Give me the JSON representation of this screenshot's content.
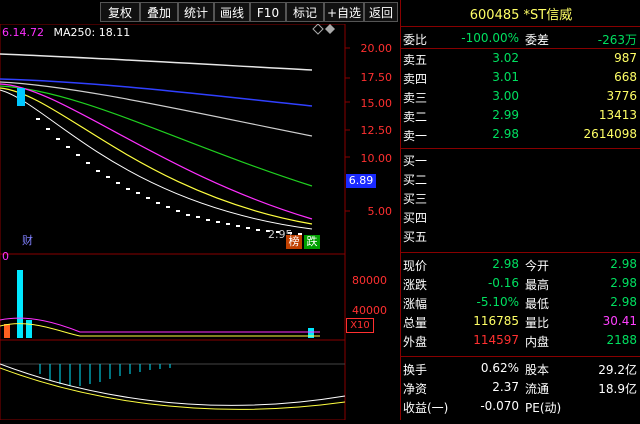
{
  "toolbar": {
    "buttons": [
      "复权",
      "叠加",
      "统计",
      "画线",
      "F10",
      "标记",
      "+自选",
      "返回"
    ]
  },
  "chart": {
    "ma_left": "6.14.72",
    "ma250": "MA250: 18.11",
    "y_axis": [
      "20.00",
      "17.50",
      "15.00",
      "12.50",
      "10.00",
      "5.00"
    ],
    "price_tag": "6.89",
    "low_label": "2.95",
    "badge_bang": "榜",
    "badge_die": "跌",
    "cai": "财",
    "vol_axis": [
      "80000",
      "40000"
    ],
    "vol_unit": "X10",
    "vol_left": "0"
  },
  "panel": {
    "title": "600485 *ST信威",
    "weibi_label": "委比",
    "weibi_value": "-100.00%",
    "weicha_label": "委差",
    "weicha_value": "-263万",
    "sells": [
      {
        "label": "卖五",
        "price": "3.02",
        "vol": "987"
      },
      {
        "label": "卖四",
        "price": "3.01",
        "vol": "668"
      },
      {
        "label": "卖三",
        "price": "3.00",
        "vol": "3776"
      },
      {
        "label": "卖二",
        "price": "2.99",
        "vol": "13413"
      },
      {
        "label": "卖一",
        "price": "2.98",
        "vol": "2614098"
      }
    ],
    "buys": [
      "买一",
      "买二",
      "买三",
      "买四",
      "买五"
    ],
    "stats": [
      {
        "l1": "现价",
        "v1": "2.98",
        "l2": "今开",
        "v2": "2.98"
      },
      {
        "l1": "涨跌",
        "v1": "-0.16",
        "l2": "最高",
        "v2": "2.98"
      },
      {
        "l1": "涨幅",
        "v1": "-5.10%",
        "l2": "最低",
        "v2": "2.98"
      },
      {
        "l1": "总量",
        "v1": "116785",
        "l2": "量比",
        "v2": "30.41"
      },
      {
        "l1": "外盘",
        "v1": "114597",
        "l2": "内盘",
        "v2": "2188"
      }
    ],
    "fund": [
      {
        "l1": "换手",
        "v1": "0.62%",
        "l2": "股本",
        "v2": "29.2亿"
      },
      {
        "l1": "净资",
        "v1": "2.37",
        "l2": "流通",
        "v2": "18.9亿"
      },
      {
        "l1": "收益(一)",
        "v1": "-0.070",
        "l2": "PE(动)",
        "v2": ""
      }
    ]
  }
}
